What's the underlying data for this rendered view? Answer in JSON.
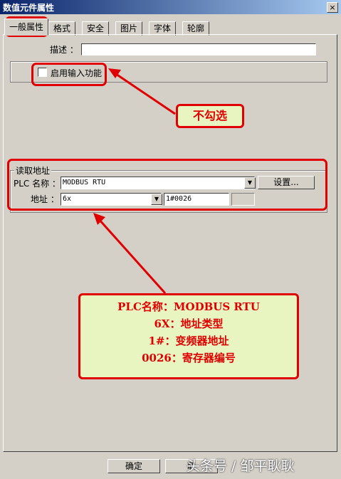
{
  "window": {
    "title": "数值元件属性",
    "close_glyph": "×"
  },
  "tabs": [
    {
      "label": "一般属性",
      "active": true
    },
    {
      "label": "格式"
    },
    {
      "label": "安全"
    },
    {
      "label": "图片"
    },
    {
      "label": "字体"
    },
    {
      "label": "轮廓"
    }
  ],
  "description": {
    "label": "描述 ：",
    "value": ""
  },
  "input_function": {
    "label": "启用输入功能",
    "checked": false
  },
  "read_address": {
    "group_title": "读取地址",
    "plc_label": "PLC 名称 ：",
    "plc_value": "MODBUS RTU",
    "settings_button": "设置...",
    "address_label": "地址 ：",
    "address_type": "6x",
    "address_value": "1#0026"
  },
  "buttons": {
    "ok": "确定",
    "cancel": "取"
  },
  "annotations": {
    "uncheck_note": "不勾选",
    "info_lines": [
      "PLC名称：MODBUS RTU",
      "6X：地址类型",
      "1#：变频器地址",
      "0026：寄存器编号"
    ],
    "color": "#e00000",
    "note_bg": "#e8f5c0"
  },
  "watermark": "头条号 / 邹平耿耿"
}
